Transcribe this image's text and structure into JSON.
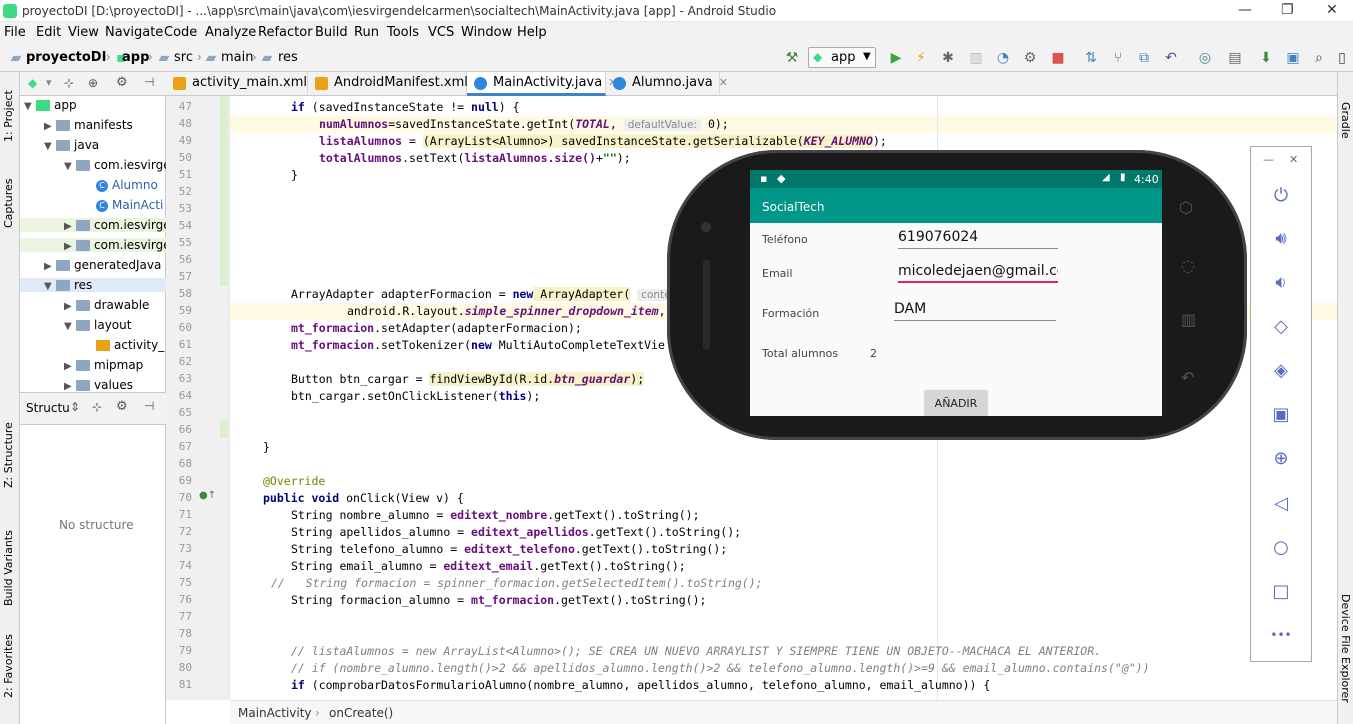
{
  "window": {
    "title": "proyectoDI [D:\\proyectoDI] - ...\\app\\src\\main\\java\\com\\iesvirgendelcarmen\\socialtech\\MainActivity.java [app] - Android Studio",
    "minimize": "—",
    "maximize": "❐",
    "close": "✕"
  },
  "menu": [
    "File",
    "Edit",
    "View",
    "Navigate",
    "Code",
    "Analyze",
    "Refactor",
    "Build",
    "Run",
    "Tools",
    "VCS",
    "Window",
    "Help"
  ],
  "nav": {
    "crumbs": [
      "proyectoDI",
      "app",
      "src",
      "main",
      "res"
    ],
    "run_config": "app"
  },
  "left_tabs": [
    "1: Project",
    "Captures",
    "Z: Structure",
    "Build Variants",
    "2: Favorites"
  ],
  "right_tabs": [
    "Gradle",
    "Device File Explorer"
  ],
  "project_panel": {
    "selector": "app",
    "tree": [
      {
        "label": "app",
        "depth": 0,
        "arrow": "▼",
        "icon": "module"
      },
      {
        "label": "manifests",
        "depth": 1,
        "arrow": "▶",
        "icon": "folder"
      },
      {
        "label": "java",
        "depth": 1,
        "arrow": "▼",
        "icon": "folder"
      },
      {
        "label": "com.iesvirge",
        "depth": 2,
        "arrow": "▼",
        "icon": "folder"
      },
      {
        "label": "Alumno",
        "depth": 3,
        "arrow": "",
        "icon": "class"
      },
      {
        "label": "MainActi",
        "depth": 3,
        "arrow": "",
        "icon": "class"
      },
      {
        "label": "com.iesvirge",
        "depth": 2,
        "arrow": "▶",
        "icon": "folder"
      },
      {
        "label": "com.iesvirge",
        "depth": 2,
        "arrow": "▶",
        "icon": "folder"
      },
      {
        "label": "generatedJava",
        "depth": 1,
        "arrow": "▶",
        "icon": "folder"
      },
      {
        "label": "res",
        "depth": 1,
        "arrow": "▼",
        "icon": "folder"
      },
      {
        "label": "drawable",
        "depth": 2,
        "arrow": "▶",
        "icon": "folder"
      },
      {
        "label": "layout",
        "depth": 2,
        "arrow": "▼",
        "icon": "folder"
      },
      {
        "label": "activity_",
        "depth": 3,
        "arrow": "",
        "icon": "layout"
      },
      {
        "label": "mipmap",
        "depth": 2,
        "arrow": "▶",
        "icon": "folder"
      },
      {
        "label": "values",
        "depth": 2,
        "arrow": "▶",
        "icon": "folder"
      }
    ]
  },
  "structure_panel": {
    "title": "Structu",
    "empty": "No structure"
  },
  "tabs": [
    {
      "label": "activity_main.xml",
      "active": false
    },
    {
      "label": "AndroidManifest.xml",
      "active": false
    },
    {
      "label": "MainActivity.java",
      "active": true
    },
    {
      "label": "Alumno.java",
      "active": false
    }
  ],
  "code": {
    "line_numbers": [
      "47",
      "48",
      "49",
      "50",
      "51",
      "52",
      "53",
      "54",
      "55",
      "56",
      "57",
      "58",
      "59",
      "60",
      "61",
      "62",
      "63",
      "64",
      "65",
      "66",
      "67",
      "68",
      "69",
      "70",
      "71",
      "72",
      "73",
      "74",
      "75",
      "76",
      "77",
      "78",
      "79",
      "80",
      "81"
    ],
    "l47": "if (savedInstanceState != null) {",
    "l48a": "numAlumnos",
    "l48b": "=savedInstanceState.getInt(",
    "l48c": "TOTAL",
    "l48d": ",",
    "l48h": "defaultValue:",
    "l48e": "0);",
    "l49a": "listaAlumnos",
    "l49b": " = ",
    "l49c": "(ArrayList<Alumno>) savedInstanceState.getSerializable(",
    "l49d": "KEY_ALUMNO",
    "l49e": ");",
    "l50a": "totalAlumnos",
    "l50b": ".setText(",
    "l50c": "listaAlumnos.size()",
    "l50d": "+",
    "l50e": "\"\"",
    "l50f": ");",
    "l51": "}",
    "l58a": "ArrayAdapter adapterFormacion = ",
    "l58b": "new",
    "l58c": " ArrayAdapter(",
    "l58h": "conte",
    "l59a": "android.R.layout.",
    "l59b": "simple_spinner_dropdown_item",
    ",": ",",
    "l60a": "mt_formacion",
    "l60b": ".setAdapter(adapterFormacion);",
    "l61a": "mt_formacion",
    "l61b": ".setTokenizer(",
    "l61c": "new",
    "l61d": " MultiAutoCompleteTextVie",
    "l63a": "Button btn_cargar = ",
    "l63b": "findViewById(R.id.",
    "l63c": "btn_guardar",
    "l63d": ");",
    "l64a": "btn_cargar.setOnClickListener(",
    "l64b": "this",
    "l64c": ");",
    "l68": "}",
    "l69": "@Override",
    "l70a": "public void",
    "l70b": " onClick(View v) {",
    "l71a": "String nombre_alumno = ",
    "l71b": "editext_nombre",
    "l71c": ".getText().toString();",
    "l72a": "String apellidos_alumno = ",
    "l72b": "editext_apellidos",
    "l72c": ".getText().toString();",
    "l73a": "String telefono_alumno = ",
    "l73b": "editext_telefono",
    "l73c": ".getText().toString();",
    "l74a": "String email_alumno = ",
    "l74b": "editext_email",
    "l74c": ".getText().toString();",
    "l75": "//   String formacion = spinner_formacion.getSelectedItem().toString();",
    "l76a": "String formacion_alumno = ",
    "l76b": "mt_formacion",
    "l76c": ".getText().toString();",
    "l79": "// listaAlumnos = new ArrayList<Alumno>(); SE CREA UN NUEVO ARRAYLIST Y SIEMPRE TIENE UN OBJETO--MACHACA EL ANTERIOR.",
    "l80": "// if (nombre_alumno.length()>2 && apellidos_alumno.length()>2 && telefono_alumno.length()>=9 && email_alumno.contains(\"@\"))",
    "l81a": "if",
    "l81b": " (comprobarDatosFormularioAlumno(nombre_alumno, apellidos_alumno, telefono_alumno, email_alumno)) {"
  },
  "bottom_breadcrumb": [
    "MainActivity",
    "onCreate()"
  ],
  "emulator": {
    "time": "4:40",
    "app_title": "SocialTech",
    "fields": [
      {
        "label": "Teléfono",
        "value": "619076024"
      },
      {
        "label": "Email",
        "value": "micoledejaen@gmail.com"
      },
      {
        "label": "Formación",
        "value": "DAM"
      }
    ],
    "total_label": "Total alumnos",
    "total_value": "2",
    "button": "AÑADIR"
  },
  "emulator_panel": {
    "minimize": "—",
    "close": "✕",
    "more": "•••"
  },
  "colors": {
    "accent": "#4083c9",
    "app_primary": "#009688",
    "app_dark": "#00796b",
    "emu_icon": "#5a6cbf"
  }
}
